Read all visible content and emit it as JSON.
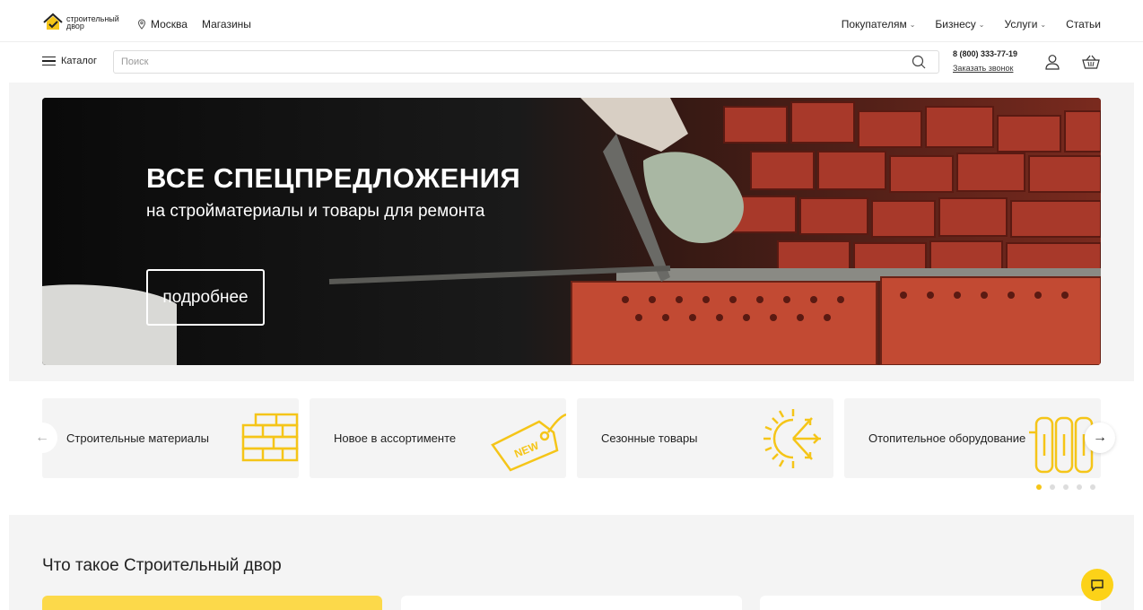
{
  "header": {
    "logo_text_line1": "строительный",
    "logo_text_line2": "двор",
    "city": "Москва",
    "shops": "Магазины",
    "nav": [
      {
        "label": "Покупателям",
        "has_dropdown": true
      },
      {
        "label": "Бизнесу",
        "has_dropdown": true
      },
      {
        "label": "Услуги",
        "has_dropdown": true
      },
      {
        "label": "Статьи",
        "has_dropdown": false
      }
    ]
  },
  "search_row": {
    "catalog_label": "Каталог",
    "search_placeholder": "Поиск",
    "search_value": "",
    "phone": "8 (800) 333-77-19",
    "callback_label": "Заказать звонок"
  },
  "hero": {
    "title": "ВСЕ СПЕЦПРЕДЛОЖЕНИЯ",
    "subtitle": "на стройматериалы и товары для ремонта",
    "button_label": "подробнее"
  },
  "categories": [
    {
      "label": "Строительные материалы",
      "icon": "bricks-icon"
    },
    {
      "label": "Новое в ассортименте",
      "icon": "new-tag-icon"
    },
    {
      "label": "Сезонные товары",
      "icon": "sun-snowflake-icon"
    },
    {
      "label": "Отопительное оборудование",
      "icon": "radiator-icon"
    }
  ],
  "carousel": {
    "dots_total": 5,
    "active_dot": 1
  },
  "about": {
    "title": "Что такое Строительный двор"
  },
  "colors": {
    "accent": "#f5c518",
    "chat_button": "#fcd218",
    "section_bg": "#f4f4f4"
  }
}
